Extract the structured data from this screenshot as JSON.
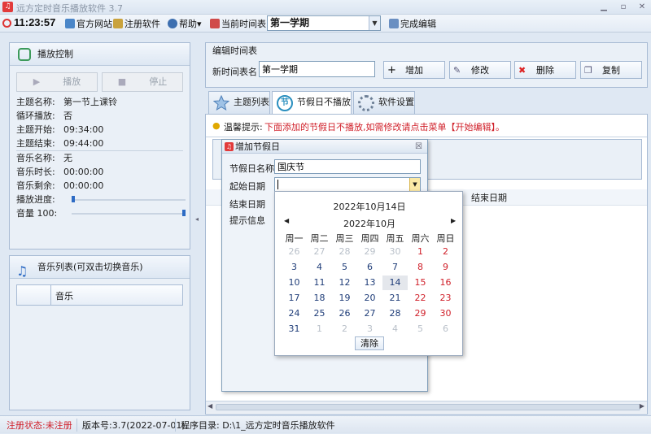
{
  "window": {
    "title": "远方定时音乐播放软件 3.7"
  },
  "toolbar": {
    "clock": "11:23:57",
    "official_site": "官方网站",
    "register": "注册软件",
    "help": "帮助",
    "current_timetable_label": "当前时间表",
    "current_timetable_value": "第一学期",
    "finish_edit": "完成编辑"
  },
  "playback": {
    "title": "播放控制",
    "play_label": "播放",
    "stop_label": "停止",
    "fields": [
      {
        "k": "主题名称:",
        "v": "第一节上课铃"
      },
      {
        "k": "循环播放:",
        "v": "否"
      },
      {
        "k": "主题开始:",
        "v": "09:34:00"
      },
      {
        "k": "主题结束:",
        "v": "09:44:00"
      },
      {
        "k": "音乐名称:",
        "v": "无"
      },
      {
        "k": "音乐时长:",
        "v": "00:00:00"
      },
      {
        "k": "音乐剩余:",
        "v": "00:00:00"
      }
    ],
    "progress_label": "播放进度:",
    "progress_value": 0,
    "volume_label": "音量 100:",
    "volume_value": 100
  },
  "music_list": {
    "title": "音乐列表(可双击切换音乐)",
    "column_header": "音乐"
  },
  "edit_timetable": {
    "group_title": "编辑时间表",
    "name_label": "新时间表名",
    "name_value": "第一学期",
    "add_label": "增加",
    "modify_label": "修改",
    "delete_label": "删除",
    "copy_label": "复制"
  },
  "tabs": [
    {
      "label": "主题列表"
    },
    {
      "label": "节假日不播放"
    },
    {
      "label": "软件设置"
    }
  ],
  "tip": {
    "prefix": "温馨提示:",
    "text": "下面添加的节假日不播放,如需修改请点击菜单【开始编辑】。"
  },
  "list_header": {
    "end_date": "结束日期"
  },
  "dialog": {
    "title": "增加节假日",
    "name_label": "节假日名称",
    "name_value": "国庆节",
    "start_label": "起始日期",
    "start_value": "",
    "end_label": "结束日期",
    "info_label": "提示信息"
  },
  "calendar": {
    "today_label": "2022年10月14日",
    "month_label": "2022年10月",
    "weekdays": [
      "周一",
      "周二",
      "周三",
      "周四",
      "周五",
      "周六",
      "周日"
    ],
    "weeks": [
      [
        "26",
        "27",
        "28",
        "29",
        "30",
        "1",
        "2"
      ],
      [
        "3",
        "4",
        "5",
        "6",
        "7",
        "8",
        "9"
      ],
      [
        "10",
        "11",
        "12",
        "13",
        "14",
        "15",
        "16"
      ],
      [
        "17",
        "18",
        "19",
        "20",
        "21",
        "22",
        "23"
      ],
      [
        "24",
        "25",
        "26",
        "27",
        "28",
        "29",
        "30"
      ],
      [
        "31",
        "1",
        "2",
        "3",
        "4",
        "5",
        "6"
      ]
    ],
    "selected_day": "14",
    "clear_label": "清除"
  },
  "statusbar": {
    "reg_status": "注册状态:未注册",
    "version": "版本号:3.7(2022-07-01)",
    "program_dir": "程序目录: D:\\1_远方定时音乐播放软件"
  }
}
